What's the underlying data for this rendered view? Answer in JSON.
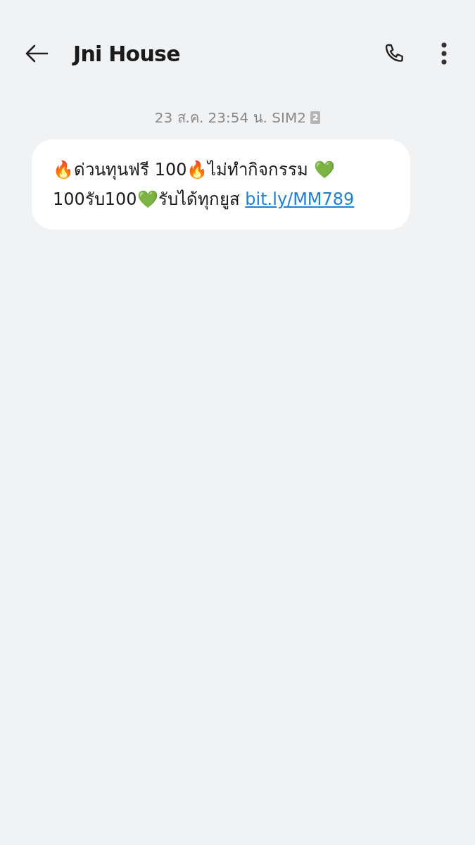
{
  "header": {
    "title": "Jni House"
  },
  "messages": [
    {
      "timestamp": "23 ส.ค. 23:54 น. SIM2",
      "sim_badge": "2",
      "text": "🔥ด่วนทุนฟรี 100🔥ไม่ทำกิจกรรม 💚100รับ100💚รับได้ทุกยูส",
      "link": "bit.ly/MM789"
    }
  ]
}
